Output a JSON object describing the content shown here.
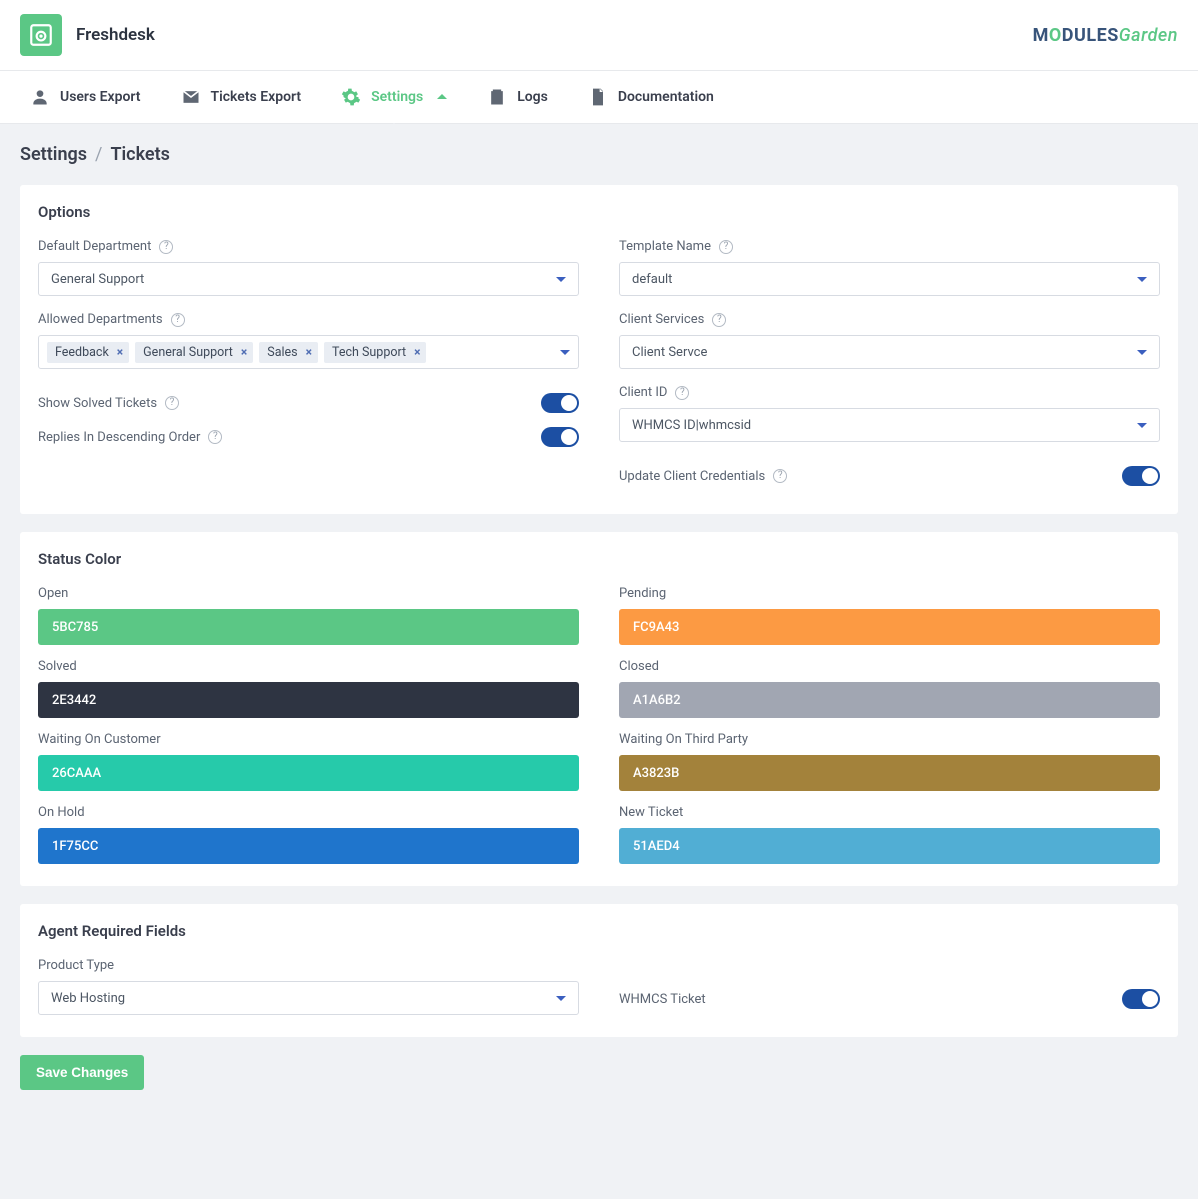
{
  "header": {
    "app_title": "Freshdesk",
    "logo_text_1": "M",
    "logo_text_2": "O",
    "logo_text_3": "DULES",
    "logo_text_4": "Garden"
  },
  "nav": {
    "users_export": "Users Export",
    "tickets_export": "Tickets Export",
    "settings": "Settings",
    "logs": "Logs",
    "documentation": "Documentation"
  },
  "breadcrumb": {
    "a": "Settings",
    "sep": "/",
    "b": "Tickets"
  },
  "options": {
    "title": "Options",
    "default_department": {
      "label": "Default Department",
      "value": "General Support"
    },
    "template_name": {
      "label": "Template Name",
      "value": "default"
    },
    "allowed_departments": {
      "label": "Allowed Departments",
      "tags": [
        "Feedback",
        "General Support",
        "Sales",
        "Tech Support"
      ]
    },
    "client_services": {
      "label": "Client Services",
      "value": "Client Servce"
    },
    "show_solved": {
      "label": "Show Solved Tickets",
      "on": true
    },
    "client_id": {
      "label": "Client ID",
      "value": "WHMCS ID|whmcsid"
    },
    "replies_desc": {
      "label": "Replies In Descending Order",
      "on": true
    },
    "update_creds": {
      "label": "Update Client Credentials",
      "on": true
    }
  },
  "status": {
    "title": "Status Color",
    "items": [
      {
        "label": "Open",
        "value": "5BC785",
        "bg": "#5BC785",
        "fg": "#ffffff"
      },
      {
        "label": "Pending",
        "value": "FC9A43",
        "bg": "#FC9A43",
        "fg": "#ffffff"
      },
      {
        "label": "Solved",
        "value": "2E3442",
        "bg": "#2E3442",
        "fg": "#ffffff"
      },
      {
        "label": "Closed",
        "value": "A1A6B2",
        "bg": "#A1A6B2",
        "fg": "#ffffff"
      },
      {
        "label": "Waiting On Customer",
        "value": "26CAAA",
        "bg": "#26CAAA",
        "fg": "#ffffff"
      },
      {
        "label": "Waiting On Third Party",
        "value": "A3823B",
        "bg": "#A3823B",
        "fg": "#ffffff"
      },
      {
        "label": "On Hold",
        "value": "1F75CC",
        "bg": "#1F75CC",
        "fg": "#ffffff"
      },
      {
        "label": "New Ticket",
        "value": "51AED4",
        "bg": "#51AED4",
        "fg": "#ffffff"
      }
    ]
  },
  "agent_fields": {
    "title": "Agent Required Fields",
    "product_type": {
      "label": "Product Type",
      "value": "Web Hosting"
    },
    "whmcs_ticket": {
      "label": "WHMCS Ticket",
      "on": true
    }
  },
  "save_button": "Save Changes"
}
